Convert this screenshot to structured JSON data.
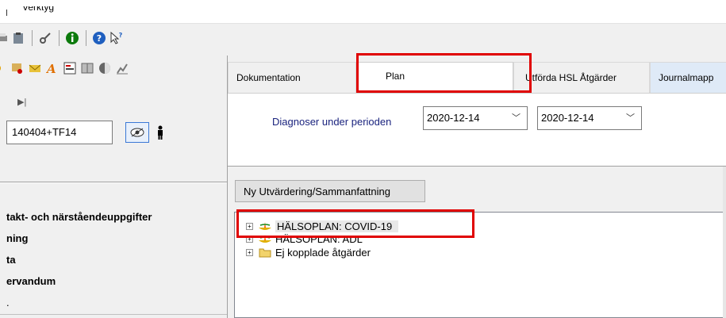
{
  "menubar": {
    "menu_item": "Verktyg"
  },
  "toolbar": {
    "icons": [
      "print-icon",
      "clipboard-icon",
      "key-icon",
      "info-icon",
      "help-icon",
      "help-cursor-icon"
    ]
  },
  "left": {
    "patient_id": "140404+TF14",
    "list": [
      "takt- och närståendeuppgifter",
      "ning",
      "ta",
      "ervandum",
      "."
    ]
  },
  "tabs": [
    {
      "label": "Dokumentation"
    },
    {
      "label": "Plan"
    },
    {
      "label": "Utförda HSL Åtgärder"
    },
    {
      "label": "Journalmapp"
    }
  ],
  "filter": {
    "label": "Diagnoser under perioden",
    "date_from": "2020-12-14",
    "date_to": "2020-12-14"
  },
  "buttons": {
    "new_evaluation": "Ny Utvärdering/Sammanfattning"
  },
  "tree": [
    {
      "label": "HÄLSOPLAN: COVID-19",
      "icon": "lamp-icon",
      "selected": true
    },
    {
      "label": "HÄLSOPLAN: ADL",
      "icon": "lamp-icon",
      "selected": false
    },
    {
      "label": "Ej kopplade åtgärder",
      "icon": "folder-icon",
      "selected": false
    }
  ],
  "colors": {
    "highlight": "#e00000",
    "label_blue": "#1a237e",
    "active_tab_tint": "#dfeaf7"
  }
}
